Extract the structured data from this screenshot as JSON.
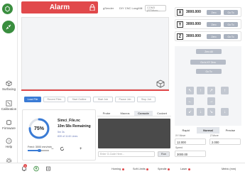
{
  "header": {
    "title": "Alarm",
    "mini_left": "gSender",
    "mini_mid": "DIY CNC LongMill",
    "select": "COM3 (STMicro..."
  },
  "sidebar": {
    "items": [
      {
        "label": "Surfacing"
      },
      {
        "label": "Calibration"
      },
      {
        "label": "Firmware"
      },
      {
        "label": "Help"
      },
      {
        "label": "Settings"
      }
    ]
  },
  "toolbar": {
    "buttons": [
      "Load File",
      "Recent Files",
      "Start Outline",
      "Start Job",
      "Pause Job",
      "Stop Job"
    ]
  },
  "job": {
    "percent": "75%",
    "percent_value": 75,
    "file_name": "Simci_File.nc",
    "remaining": "10m 58s Remaining",
    "elapsed": "5m 3s",
    "lines": "839 of 1140 Lines",
    "feed_label": "Feed: 3000 mm/min",
    "feed_fraction": 0.55,
    "minus": "−",
    "plus": "+"
  },
  "console": {
    "tabs": [
      "Probe",
      "Macros",
      "Console",
      "Coolant"
    ],
    "active_tab": "Console",
    "input_placeholder": "Enter G-Code Here...",
    "run_label": "Run"
  },
  "dro": {
    "axes": [
      {
        "axis": "X",
        "value": "3000.000",
        "zero": "Zero",
        "goto": "Go To"
      },
      {
        "axis": "Y",
        "value": "3000.000",
        "zero": "Zero",
        "goto": "Go To"
      },
      {
        "axis": "Z",
        "value": "3000.000",
        "zero": "Zero",
        "goto": "Go To"
      }
    ],
    "zero_all": "Zero All",
    "goto_xy": "Go to XY Zero",
    "go_to": "Go To"
  },
  "speed": {
    "tabs": [
      "Rapid",
      "Normal",
      "Precise"
    ],
    "active": "Normal",
    "xy_label": "XY Move",
    "xy_value": "12.000",
    "z_label": "Z Move",
    "z_value": "2.000",
    "speed_label": "Speed",
    "speed_value": "3000.00"
  },
  "bottombar": {
    "notifications": "1",
    "statuses": [
      "Homing",
      "Soft Limits",
      "Spindle",
      "Laser"
    ],
    "extra": "Metric (mm)"
  },
  "colors": {
    "alarm": "#e1494b",
    "primary": "#3a7bd5",
    "brand": "#3a8e3f"
  }
}
